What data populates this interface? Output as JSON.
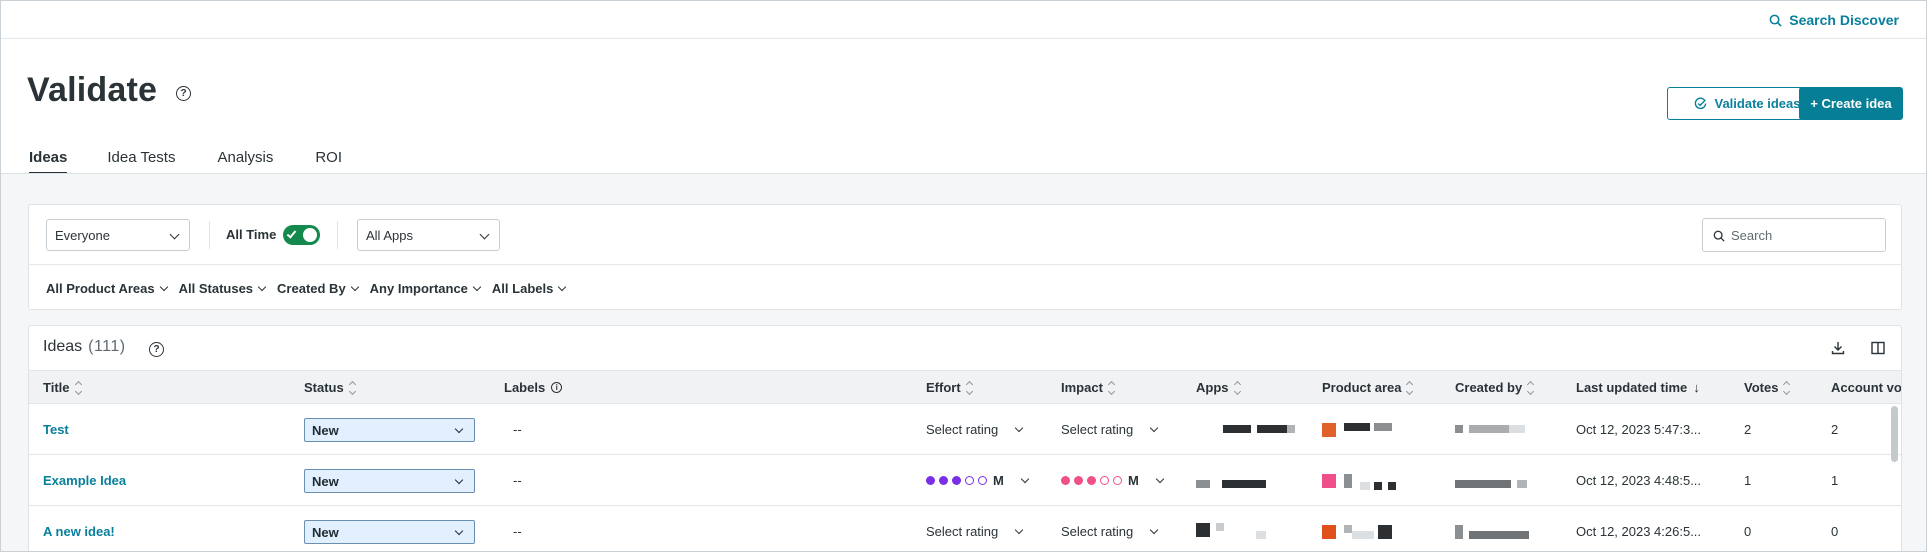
{
  "header": {
    "search_label": "Search Discover"
  },
  "page": {
    "title": "Validate",
    "help_icon": "?"
  },
  "actions": {
    "validate_label": "Validate ideas",
    "create_label": "+ Create idea"
  },
  "tabs": [
    {
      "label": "Ideas",
      "active": true
    },
    {
      "label": "Idea Tests",
      "active": false
    },
    {
      "label": "Analysis",
      "active": false
    },
    {
      "label": "ROI",
      "active": false
    }
  ],
  "filters": {
    "people": "Everyone",
    "time_label": "All Time",
    "time_toggle_on": true,
    "apps": "All Apps",
    "search_placeholder": "Search",
    "dropdowns": [
      "All Product Areas",
      "All Statuses",
      "Created By",
      "Any Importance",
      "All Labels"
    ]
  },
  "table": {
    "title": "Ideas",
    "count": "(111)",
    "columns": {
      "title": "Title",
      "status": "Status",
      "labels": "Labels",
      "effort": "Effort",
      "impact": "Impact",
      "apps": "Apps",
      "product_area": "Product area",
      "created_by": "Created by",
      "last_updated": "Last updated time",
      "votes": "Votes",
      "account_votes": "Account vo"
    },
    "rows": [
      {
        "title": "Test",
        "status": "New",
        "labels": "--",
        "effort": "Select rating",
        "impact": "Select rating",
        "last_updated": "Oct 12, 2023 5:47:3...",
        "votes": "2",
        "account_votes": "2"
      },
      {
        "title": "Example Idea",
        "status": "New",
        "labels": "--",
        "effort": "M",
        "effort_level": 3,
        "impact": "M",
        "impact_level": 3,
        "last_updated": "Oct 12, 2023 4:48:5...",
        "votes": "1",
        "account_votes": "1"
      },
      {
        "title": "A new idea!",
        "status": "New",
        "labels": "--",
        "effort": "Select rating",
        "impact": "Select rating",
        "last_updated": "Oct 12, 2023 4:26:5...",
        "votes": "0",
        "account_votes": "0"
      }
    ]
  },
  "colors": {
    "accent": "#087f9c",
    "primary_button": "#067e96",
    "toggle": "#13894d",
    "effort_dot": "#7a2ee6",
    "impact_dot": "#f0508a"
  }
}
